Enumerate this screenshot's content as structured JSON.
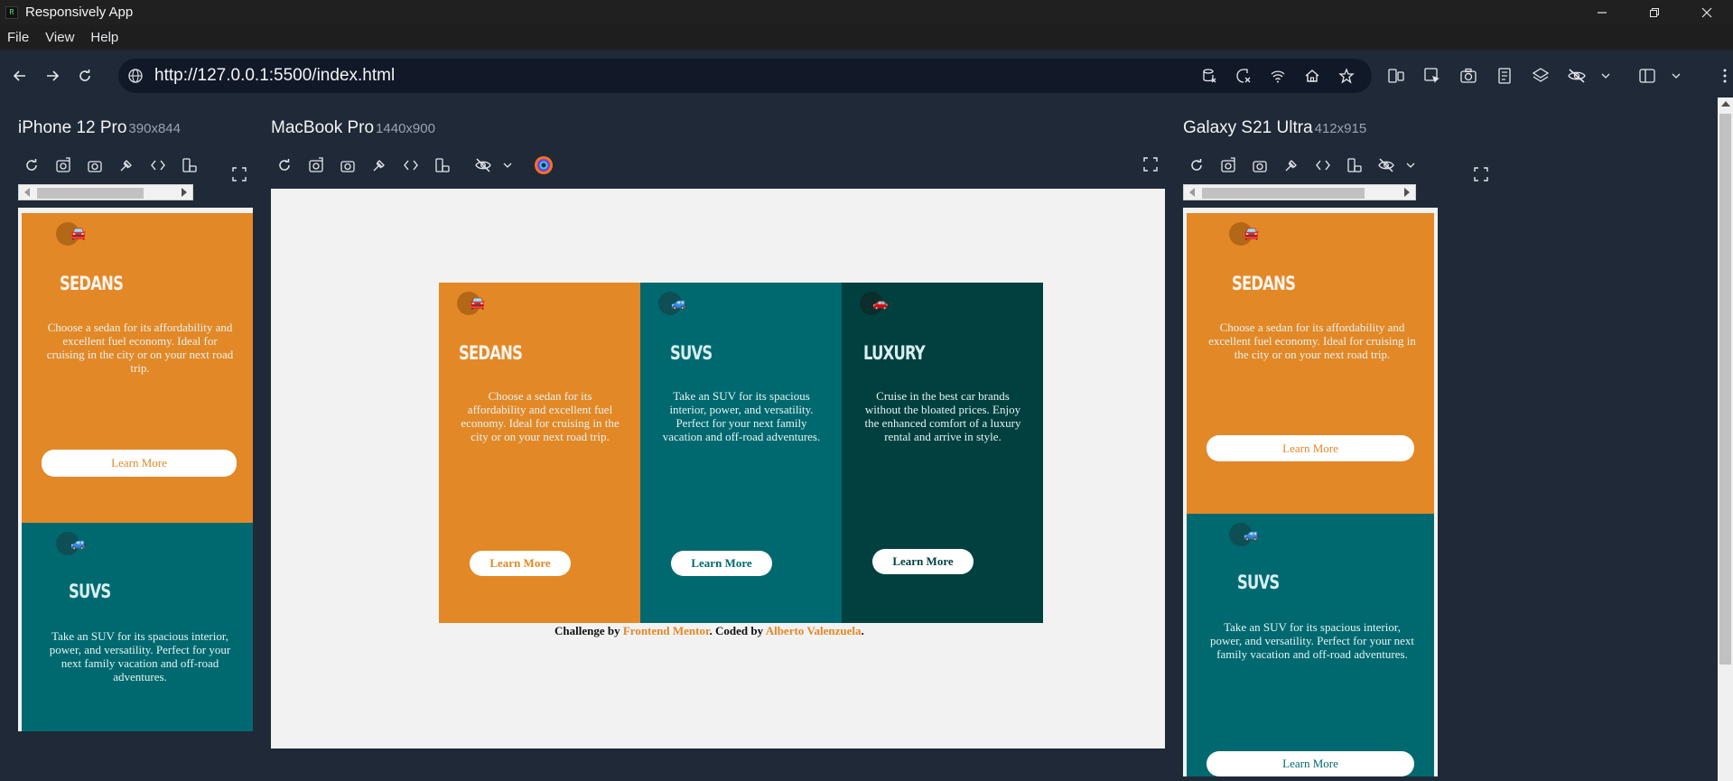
{
  "window": {
    "title": "Responsively App"
  },
  "menu": [
    "File",
    "View",
    "Help"
  ],
  "address": {
    "url": "http://127.0.0.1:5500/index.html"
  },
  "devices": [
    {
      "name": "iPhone 12 Pro",
      "size": "390x844"
    },
    {
      "name": "MacBook Pro",
      "size": "1440x900"
    },
    {
      "name": "Galaxy S21 Ultra",
      "size": "412x915"
    }
  ],
  "cards": {
    "sedans": {
      "title": "SEDANS",
      "text": "Choose a sedan for its affordability and excellent fuel economy. Ideal for cruising in the city or on your next road trip.",
      "button": "Learn More",
      "color": "#e38826"
    },
    "suvs": {
      "title": "SUVS",
      "text": "Take an SUV for its spacious interior, power, and versatility. Perfect for your next family vacation and off-road adventures.",
      "button": "Learn More",
      "color": "#006970"
    },
    "luxury": {
      "title": "LUXURY",
      "text": "Cruise in the best car brands without the bloated prices. Enjoy the enhanced comfort of a luxury rental and arrive in style.",
      "button": "Learn More",
      "color": "#00403f"
    }
  },
  "footer": {
    "prefix": "Challenge by",
    "link1": "Frontend Mentor",
    "middle": ". Coded by",
    "link2": "Alberto Valenzuela",
    "suffix": "."
  },
  "icons": {
    "car": "car-icon"
  }
}
